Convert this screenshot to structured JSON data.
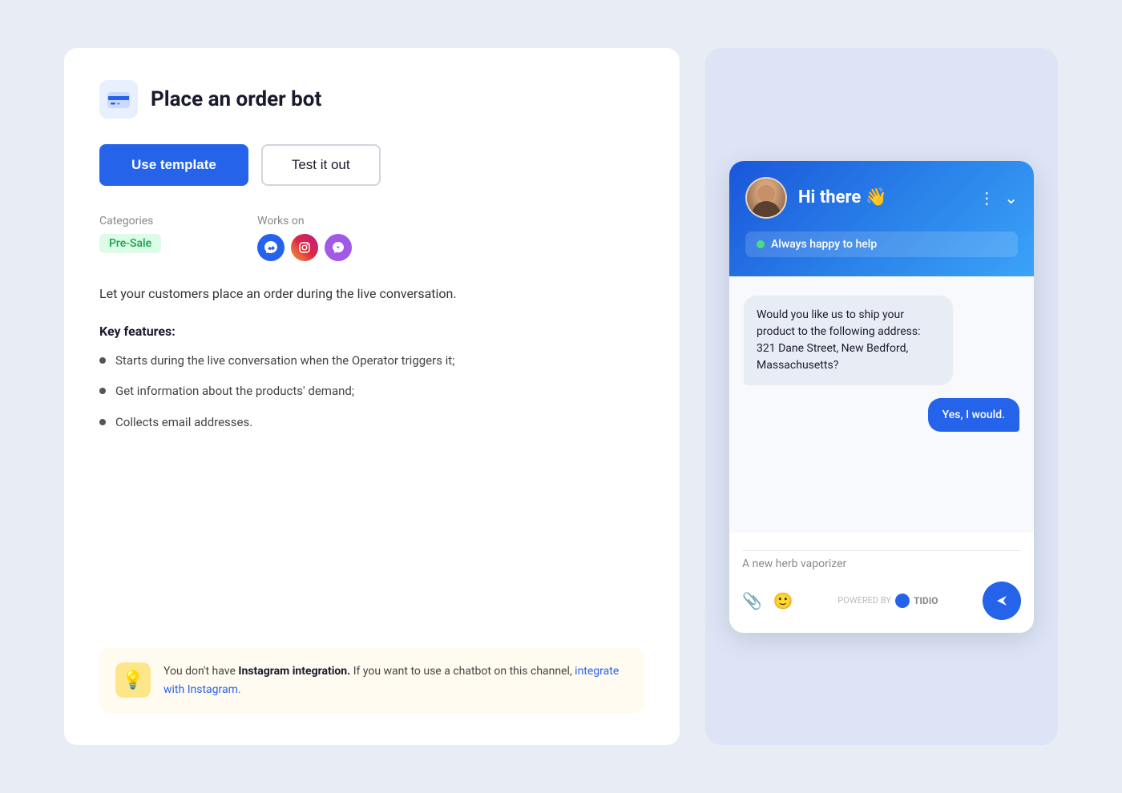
{
  "page": {
    "background": "#e8ecf5"
  },
  "bot": {
    "title": "Place an order bot",
    "icon_label": "bot-icon"
  },
  "buttons": {
    "use_template": "Use template",
    "test_it_out": "Test it out"
  },
  "meta": {
    "categories_label": "Categories",
    "category_badge": "Pre-Sale",
    "works_on_label": "Works on"
  },
  "description": "Let your customers place an order during the live conversation.",
  "key_features": {
    "title": "Key features:",
    "items": [
      "Starts during the live conversation when the Operator triggers it;",
      "Get information about the products' demand;",
      "Collects email addresses."
    ]
  },
  "notification": {
    "icon": "💡",
    "text_start": "You don't have ",
    "text_bold": "Instagram integration.",
    "text_middle": " If you want to use a chatbot on this channel, ",
    "link_text": "integrate with Instagram.",
    "link_href": "#"
  },
  "chat_preview": {
    "greeting": "Hi there 👋",
    "status": "Always happy to help",
    "messages": [
      {
        "type": "bot",
        "text": "Would you like us to ship your product to the following address: 321 Dane Street, New Bedford, Massachusetts?"
      },
      {
        "type": "user",
        "text": "Yes, I would."
      }
    ],
    "input_placeholder": "A new herb vaporizer",
    "powered_by": "POWERED BY",
    "brand": "TIDIO",
    "menu_icon": "⋮",
    "chevron_icon": "⌄"
  }
}
